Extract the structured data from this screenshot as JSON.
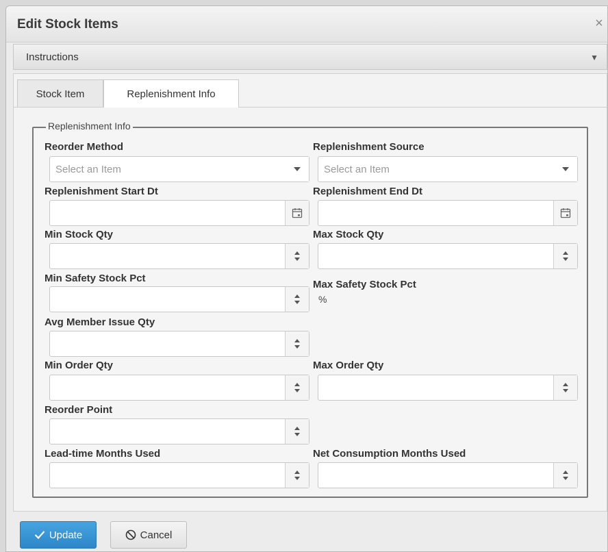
{
  "dialog": {
    "title": "Edit Stock Items",
    "close_glyph": "×"
  },
  "instructions": {
    "label": "Instructions",
    "caret": "▼"
  },
  "tabs": [
    {
      "label": "Stock Item",
      "active": false
    },
    {
      "label": "Replenishment Info",
      "active": true
    }
  ],
  "fieldset": {
    "legend": "Replenishment Info"
  },
  "fields": {
    "reorder_method": {
      "label": "Reorder Method",
      "placeholder": "Select an Item",
      "icon": "chevron-down-icon"
    },
    "replenishment_source": {
      "label": "Replenishment Source",
      "placeholder": "Select an Item",
      "icon": "chevron-down-icon"
    },
    "replenishment_start_dt": {
      "label": "Replenishment Start Dt",
      "value": "",
      "icon": "calendar-icon"
    },
    "replenishment_end_dt": {
      "label": "Replenishment End Dt",
      "value": "",
      "icon": "calendar-icon"
    },
    "min_stock_qty": {
      "label": "Min Stock Qty",
      "value": "",
      "icon": "spinner-icon"
    },
    "max_stock_qty": {
      "label": "Max Stock Qty",
      "value": "",
      "icon": "spinner-icon"
    },
    "min_safety_stock_pct": {
      "label": "Min Safety Stock Pct",
      "value": "",
      "icon": "spinner-icon"
    },
    "max_safety_stock_pct": {
      "label": "Max Safety Stock Pct",
      "value": "%"
    },
    "avg_member_issue_qty": {
      "label": "Avg Member Issue Qty",
      "value": "",
      "icon": "spinner-icon"
    },
    "min_order_qty": {
      "label": "Min Order Qty",
      "value": "",
      "icon": "spinner-icon"
    },
    "max_order_qty": {
      "label": "Max Order Qty",
      "value": "",
      "icon": "spinner-icon"
    },
    "reorder_point": {
      "label": "Reorder Point",
      "value": "",
      "icon": "spinner-icon"
    },
    "lead_time_months_used": {
      "label": "Lead-time Months Used",
      "value": "",
      "icon": "spinner-icon"
    },
    "net_consumption_months_used": {
      "label": "Net Consumption Months Used",
      "value": "",
      "icon": "spinner-icon"
    }
  },
  "buttons": {
    "update": {
      "label": "Update",
      "icon": "check-icon",
      "color": "#3a97d8"
    },
    "cancel": {
      "label": "Cancel",
      "icon": "cancel-icon"
    }
  }
}
